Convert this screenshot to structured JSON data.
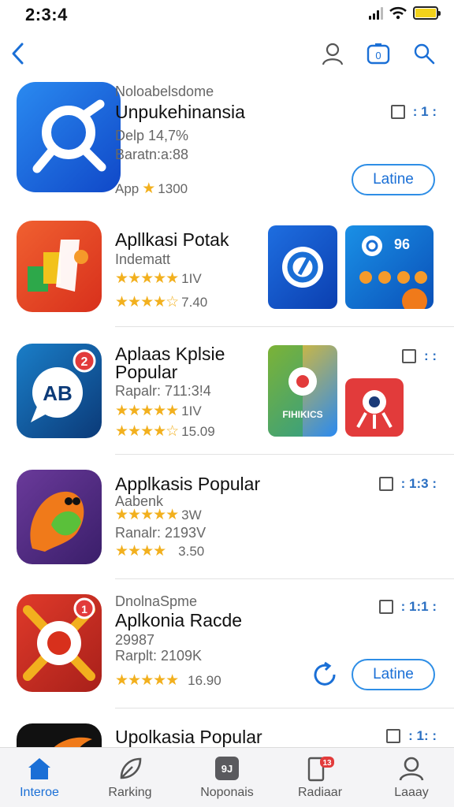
{
  "status": {
    "time": "2:3:4"
  },
  "featured": {
    "kicker": "Noloabelsdome",
    "title": "Unpukehinansia",
    "meta1": "Delp 14,7%",
    "meta2": "Baratn:a:88",
    "rating_prefix": "App",
    "rating_count": "1300",
    "open_label": "Latine",
    "dots": ": 1 :"
  },
  "apps": [
    {
      "title": "Apllkasi Potak",
      "sub": "Indematt",
      "stars1": "★★★★★",
      "r1": "1IV",
      "stars2": "★★★★☆",
      "r2": "7.40"
    },
    {
      "title_l1": "Aplaas Kplsie",
      "title_l2": "Popular",
      "sub": "Rapalr: 711:3!4",
      "stars1": "★★★★★",
      "r1": "1IV",
      "stars2": "★★★★☆",
      "r2": "15.09",
      "dots": ": :",
      "badge": "2"
    },
    {
      "title": "Applkasis Popular",
      "sub": "Aabenk",
      "stars1": "★★★★★",
      "r1": "3W",
      "sub2": "Ranalr: 2193V",
      "stars2": "★★★★",
      "r2": "3.50",
      "dots": ": 1:3 :"
    },
    {
      "kicker": "DnolnaSpme",
      "title": "Aplkonia Racde",
      "sub": "29987",
      "sub2": "Rarplt: 2109K",
      "stars1": "★★★★★",
      "r1": "16.90",
      "open_label": "Latine",
      "dots": ": 1:1 :",
      "badge": "1"
    },
    {
      "title": "Upolkasia Popular",
      "dots": ": 1: :"
    }
  ],
  "tabs": [
    {
      "label": "Interoe"
    },
    {
      "label": "Rarking"
    },
    {
      "label": "Noponais"
    },
    {
      "label": "Radiaar"
    },
    {
      "label": "Laaay"
    }
  ],
  "tab_badge": "13",
  "nav_icon_text": "0",
  "shot_texts": {
    "s1": "96",
    "s2": "FIHIKICS"
  },
  "colors": {
    "accent": "#1a6fd6",
    "star": "#f2b01e",
    "badge": "#e23b3b"
  },
  "icons": [
    "back-chevron-icon",
    "profile-icon",
    "camera-icon",
    "search-icon",
    "star-icon",
    "more-dots-icon",
    "today-icon",
    "ranking-icon",
    "apps-icon",
    "arcade-icon",
    "account-icon"
  ]
}
